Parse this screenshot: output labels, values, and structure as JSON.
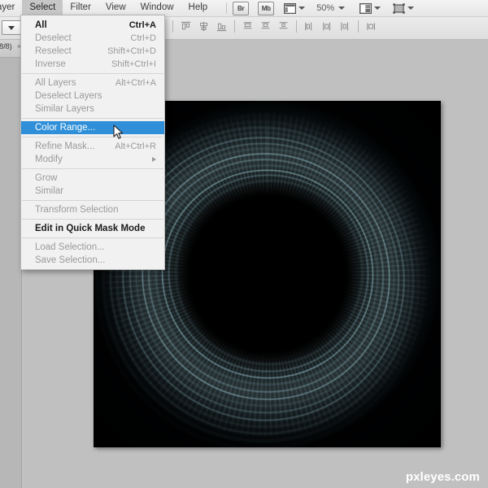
{
  "app": {
    "name": "Adobe Photoshop",
    "background_color": "#c0c0c0"
  },
  "menubar": {
    "items": [
      {
        "label": "ayer",
        "active": false,
        "clipped": true
      },
      {
        "label": "Select",
        "active": true,
        "clipped": false
      },
      {
        "label": "Filter",
        "active": false,
        "clipped": false
      },
      {
        "label": "View",
        "active": false,
        "clipped": false
      },
      {
        "label": "Window",
        "active": false,
        "clipped": false
      },
      {
        "label": "Help",
        "active": false,
        "clipped": false
      }
    ],
    "bridge_button": "Br",
    "minibridge_button": "Mb",
    "zoom_level": "50%",
    "icons": [
      "arrange-documents-icon",
      "screen-mode-icon",
      "workspace-switcher-icon"
    ]
  },
  "options_bar": {
    "align_icons": [
      "align-left-edges-icon",
      "align-horizontal-centers-icon",
      "align-right-edges-icon",
      "align-top-edges-icon",
      "align-vertical-centers-icon",
      "align-bottom-edges-icon",
      "distribute-left-edges-icon",
      "distribute-horizontal-centers-icon",
      "distribute-right-edges-icon",
      "distribute-spacing-icon"
    ]
  },
  "document_tab": {
    "label": "8/8)",
    "close_glyph": "×"
  },
  "menu": {
    "title": "Select",
    "highlight_color": "#2f90d9",
    "groups": [
      {
        "items": [
          {
            "label": "All",
            "shortcut": "Ctrl+A",
            "state": "bold",
            "submenu": false
          },
          {
            "label": "Deselect",
            "shortcut": "Ctrl+D",
            "state": "disabled",
            "submenu": false
          },
          {
            "label": "Reselect",
            "shortcut": "Shift+Ctrl+D",
            "state": "disabled",
            "submenu": false
          },
          {
            "label": "Inverse",
            "shortcut": "Shift+Ctrl+I",
            "state": "disabled",
            "submenu": false
          }
        ]
      },
      {
        "items": [
          {
            "label": "All Layers",
            "shortcut": "Alt+Ctrl+A",
            "state": "disabled",
            "submenu": false
          },
          {
            "label": "Deselect Layers",
            "shortcut": "",
            "state": "disabled",
            "submenu": false
          },
          {
            "label": "Similar Layers",
            "shortcut": "",
            "state": "disabled",
            "submenu": false
          }
        ]
      },
      {
        "items": [
          {
            "label": "Color Range...",
            "shortcut": "",
            "state": "selected",
            "submenu": false
          }
        ]
      },
      {
        "items": [
          {
            "label": "Refine Mask...",
            "shortcut": "Alt+Ctrl+R",
            "state": "disabled",
            "submenu": false
          },
          {
            "label": "Modify",
            "shortcut": "",
            "state": "disabled",
            "submenu": true
          }
        ]
      },
      {
        "items": [
          {
            "label": "Grow",
            "shortcut": "",
            "state": "disabled",
            "submenu": false
          },
          {
            "label": "Similar",
            "shortcut": "",
            "state": "disabled",
            "submenu": false
          }
        ]
      },
      {
        "items": [
          {
            "label": "Transform Selection",
            "shortcut": "",
            "state": "disabled",
            "submenu": false
          }
        ]
      },
      {
        "items": [
          {
            "label": "Edit in Quick Mask Mode",
            "shortcut": "",
            "state": "bold",
            "submenu": false
          }
        ]
      },
      {
        "items": [
          {
            "label": "Load Selection...",
            "shortcut": "",
            "state": "disabled",
            "submenu": false
          },
          {
            "label": "Save Selection...",
            "shortcut": "",
            "state": "disabled",
            "submenu": false
          }
        ]
      }
    ]
  },
  "canvas": {
    "artwork_description": "concentric glowing teal light rings on black background",
    "background_color": "#000000",
    "ring_color": "#a8d8e2"
  },
  "watermark": {
    "text": "pxleyes.com",
    "color": "#ffffff"
  },
  "cursor": {
    "type": "arrow-pointer"
  }
}
